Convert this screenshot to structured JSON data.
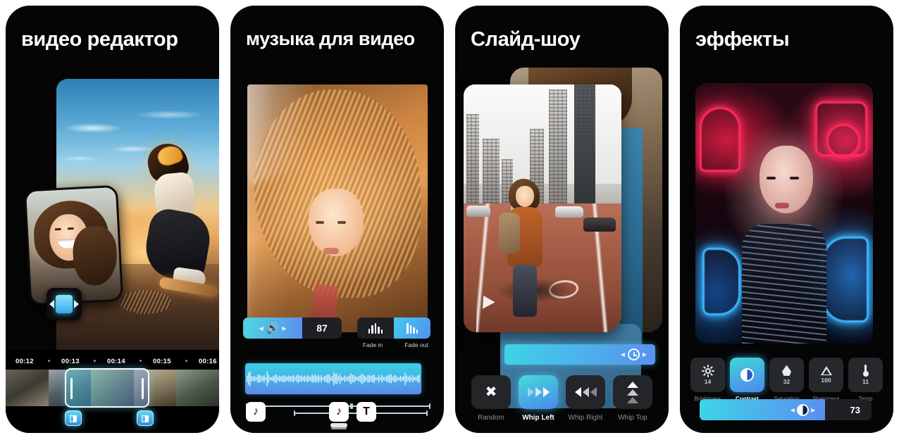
{
  "app": {
    "background_color": "#ffffff",
    "panel_background": "#050505",
    "accent_cyan": "#3ed3e6",
    "accent_blue": "#5a8df0"
  },
  "panels": [
    {
      "id": "video-editor",
      "title": "видео редактор",
      "timeline": {
        "timestamps": [
          "00:12",
          "00:13",
          "00:14",
          "00:15",
          "00:16"
        ],
        "selected_clip": true,
        "transition_markers": 2
      },
      "tools": {
        "crop_icon": "crop-pip-icon"
      }
    },
    {
      "id": "music-for-video",
      "title": "музыка для видео",
      "volume": {
        "value": "87",
        "icon": "speaker-icon"
      },
      "fade": {
        "in_label": "Fade in",
        "out_label": "Fade out",
        "in_active": false,
        "out_active": true,
        "icon": "audio-bars-icon"
      },
      "bottom_bar": {
        "music_icon": "music-note-icon",
        "music_stack_icon": "music-note-stack-icon",
        "text_icon": "text-T-icon"
      }
    },
    {
      "id": "slideshow",
      "title": "Слайд-шоу",
      "duration_bar": {
        "icon": "clock-icon"
      },
      "transitions": [
        {
          "label": "Random",
          "icon": "shuffle-icon",
          "active": false
        },
        {
          "label": "Whip Left",
          "icon": "arrows-right-icon",
          "active": true
        },
        {
          "label": "Whip Right",
          "icon": "arrows-left-icon",
          "active": false
        },
        {
          "label": "Whip Top",
          "icon": "arrows-up-icon",
          "active": false
        }
      ]
    },
    {
      "id": "effects",
      "title": "эффекты",
      "adjustments": [
        {
          "label": "Brightness",
          "value": "14",
          "icon": "sun-icon",
          "active": false
        },
        {
          "label": "Contrast",
          "value": "",
          "icon": "contrast-icon",
          "active": true
        },
        {
          "label": "Saturation",
          "value": "32",
          "icon": "droplet-icon",
          "active": false
        },
        {
          "label": "Sharpness",
          "value": "100",
          "icon": "triangle-icon",
          "active": false
        },
        {
          "label": "Temp",
          "value": "11",
          "icon": "thermometer-icon",
          "active": false
        }
      ],
      "slider": {
        "value": "73",
        "fill_percent": 73,
        "handle_icon": "contrast-icon"
      }
    }
  ]
}
